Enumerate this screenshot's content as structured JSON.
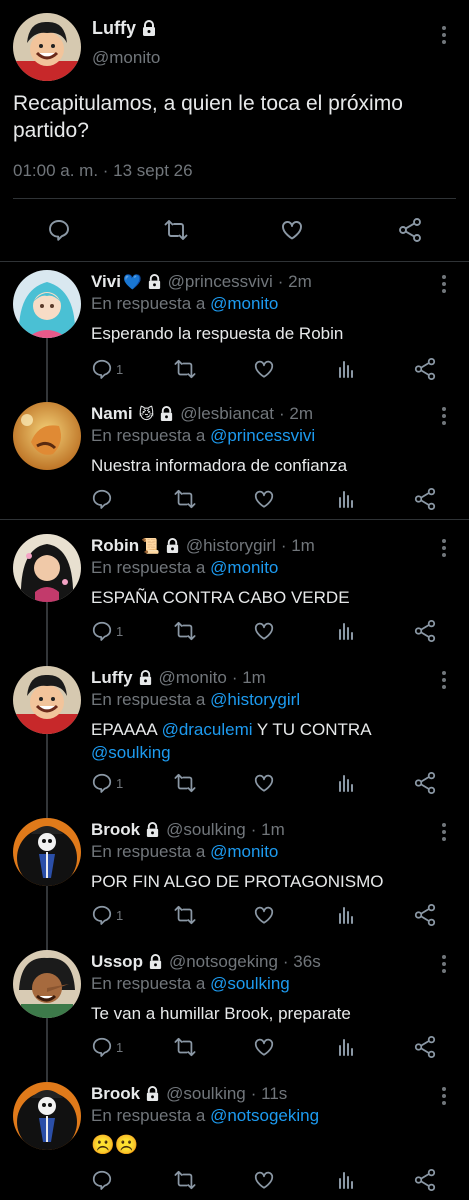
{
  "main_tweet": {
    "name": "Luffy",
    "handle": "@monito",
    "text": "Recapitulamos, a quien le toca el próximo partido?",
    "timestamp": "01:00 a. m. · 13 sept 26"
  },
  "replies": [
    {
      "name": "Vivi",
      "emoji": "💙",
      "handle": "@princessvivi",
      "time": "· 2m",
      "in_reply_label": "En respuesta a",
      "reply_to": "@monito",
      "text_parts": [
        "Esperando la respuesta de Robin"
      ],
      "reply_count": "1"
    },
    {
      "name": "Nami",
      "emoji": "😼",
      "handle": "@lesbiancat",
      "time": "· 2m",
      "in_reply_label": "En respuesta a",
      "reply_to": "@princessvivi",
      "text_parts": [
        "Nuestra informadora de confianza"
      ],
      "reply_count": ""
    },
    {
      "name": "Robin",
      "emoji": "📜",
      "handle": "@historygirl",
      "time": "· 1m",
      "in_reply_label": "En respuesta a",
      "reply_to": "@monito",
      "text_parts": [
        "ESPAÑA CONTRA CABO VERDE"
      ],
      "reply_count": "1"
    },
    {
      "name": "Luffy",
      "emoji": "",
      "handle": "@monito",
      "time": "· 1m",
      "in_reply_label": "En respuesta a",
      "reply_to": "@historygirl",
      "text_parts": [
        "EPAAAA ",
        "@draculemi",
        " Y TU CONTRA ",
        "@soulking"
      ],
      "reply_count": "1"
    },
    {
      "name": "Brook",
      "emoji": "",
      "handle": "@soulking",
      "time": "· 1m",
      "in_reply_label": "En respuesta a",
      "reply_to": "@monito",
      "text_parts": [
        "POR FIN ALGO DE PROTAGONISMO"
      ],
      "reply_count": "1"
    },
    {
      "name": "Ussop",
      "emoji": "",
      "handle": "@notsogeking",
      "time": "· 36s",
      "in_reply_label": "En respuesta a",
      "reply_to": "@soulking",
      "text_parts": [
        "Te van a humillar Brook, preparate"
      ],
      "reply_count": "1"
    },
    {
      "name": "Brook",
      "emoji": "",
      "handle": "@soulking",
      "time": "· 11s",
      "in_reply_label": "En respuesta a",
      "reply_to": "@notsogeking",
      "text_parts": [
        "☹️☹️"
      ],
      "reply_count": ""
    }
  ],
  "icons": {
    "main_actions": [
      "reply-icon",
      "retweet-icon",
      "like-icon",
      "share-icon"
    ],
    "reply_actions": [
      "reply-icon",
      "retweet-icon",
      "like-icon",
      "analytics-icon",
      "share-icon"
    ]
  },
  "colors": {
    "background": "#000000",
    "text": "#e7e9ea",
    "secondary": "#71767b",
    "link": "#1d9bf0",
    "divider": "#2f3336"
  }
}
